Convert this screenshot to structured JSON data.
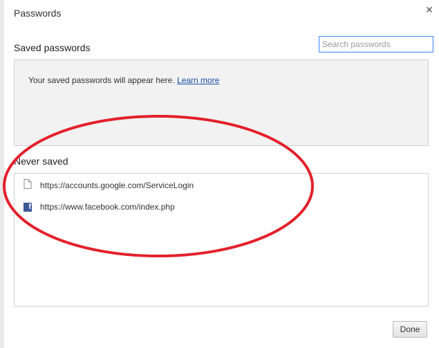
{
  "dialog": {
    "title": "Passwords",
    "close_icon": "close-icon"
  },
  "saved": {
    "heading": "Saved passwords",
    "search_placeholder": "Search passwords",
    "empty_text": "Your saved passwords will appear here.",
    "learn_more": "Learn more"
  },
  "never_saved": {
    "heading": "Never saved",
    "items": [
      {
        "icon": "page-icon",
        "url": "https://accounts.google.com/ServiceLogin"
      },
      {
        "icon": "facebook-icon",
        "url": "https://www.facebook.com/index.php"
      }
    ]
  },
  "footer": {
    "done_label": "Done"
  },
  "colors": {
    "annotation_ellipse": "#e3202b",
    "link": "#1a4fa3",
    "search_focus_border": "#4d90fe",
    "facebook_blue": "#3b5998"
  }
}
